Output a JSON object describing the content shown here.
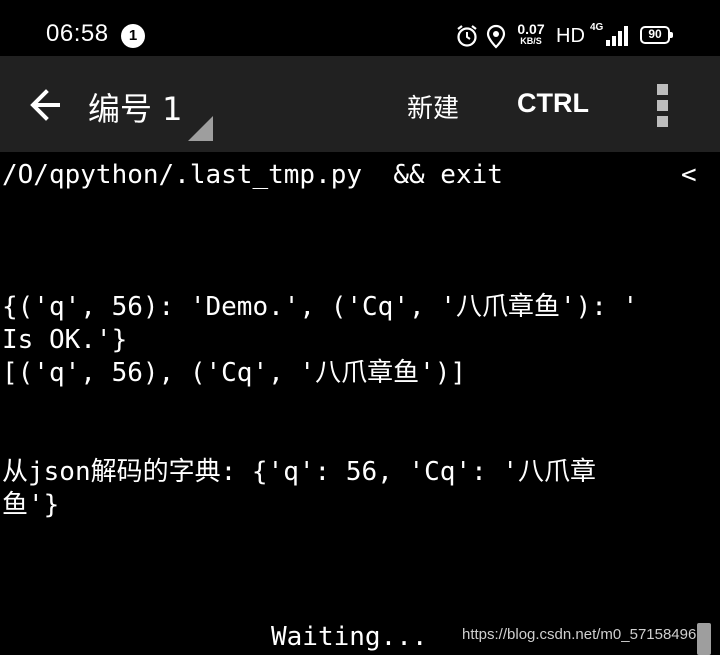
{
  "status_bar": {
    "time": "06:58",
    "notification_count": "1",
    "network_speed_value": "0.07",
    "network_speed_unit": "KB/S",
    "hd": "HD",
    "network_type": "4G",
    "battery": "90",
    "icons": [
      "alarm-icon",
      "location-icon",
      "signal-icon",
      "battery-icon"
    ]
  },
  "action_bar": {
    "title": "编号 1",
    "new_label": "新建",
    "ctrl_label": "CTRL",
    "icons": [
      "back-arrow-icon",
      "dropdown-triangle-icon",
      "overflow-menu-icon"
    ]
  },
  "terminal": {
    "lines": [
      "/O/qpython/.last_tmp.py  && exit",
      "{('q', 56): 'Demo.', ('Cq', '八爪章鱼'): '",
      "Is OK.'}",
      "[('q', 56), ('Cq', '八爪章鱼')]",
      "从json解码的字典: {'q': 56, 'Cq': '八爪章",
      "鱼'}",
      "Waiting..."
    ],
    "scroll_indicator": "<"
  },
  "watermark": "https://blog.csdn.net/m0_57158496",
  "colors": {
    "background": "#000000",
    "action_bar": "#212121",
    "text": "#ffffff"
  }
}
